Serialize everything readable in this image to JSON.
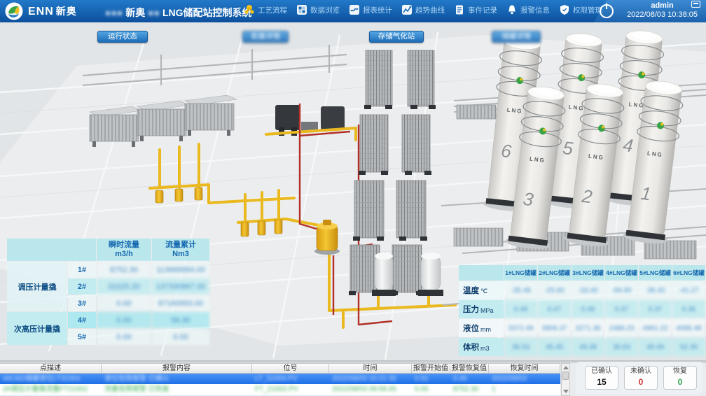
{
  "header": {
    "brand": "ENN",
    "brand_cn": "新奥",
    "title": {
      "blur_left": "●●●",
      "part1": "新奥",
      "blur_mid": "●●",
      "part2": "LNG储配站控制系统"
    },
    "toolbar": [
      {
        "label": "工艺流程",
        "icon": "process-flow-icon"
      },
      {
        "label": "数据浏览",
        "icon": "data-browse-icon"
      },
      {
        "label": "报表统计",
        "icon": "report-stats-icon"
      },
      {
        "label": "趋势曲线",
        "icon": "trend-curve-icon"
      },
      {
        "label": "事件记录",
        "icon": "event-log-icon"
      },
      {
        "label": "报警信息",
        "icon": "alarm-bell-icon"
      },
      {
        "label": "权限管理",
        "icon": "permission-shield-icon"
      }
    ],
    "user": "admin",
    "datetime": "2022/08/03 10:38:05"
  },
  "nav": {
    "buttons": [
      {
        "label": "运行状态"
      },
      {
        "label": "泵撬详情"
      },
      {
        "label": "存储气化站"
      },
      {
        "label": "储罐详情"
      }
    ]
  },
  "scene": {
    "tanks": [
      {
        "number": "6",
        "label": "LNG"
      },
      {
        "number": "5",
        "label": "LNG"
      },
      {
        "number": "4",
        "label": "LNG"
      },
      {
        "number": "3",
        "label": "LNG"
      },
      {
        "number": "2",
        "label": "LNG"
      },
      {
        "number": "1",
        "label": "LNG"
      }
    ]
  },
  "left_table": {
    "headers": {
      "flow": "瞬时流量",
      "flow_unit": "m3/h",
      "total": "流量累计",
      "total_unit": "Nm3"
    },
    "groups": [
      {
        "label": "调压计量撬"
      },
      {
        "label": "次高压计量撬"
      }
    ],
    "rows": [
      {
        "id": "1#",
        "flow": "8752.30",
        "total": "113666884.00"
      },
      {
        "id": "2#",
        "flow": "31025.20",
        "total": "137330867.00"
      },
      {
        "id": "3#",
        "flow": "0.00",
        "total": "87160993.00"
      },
      {
        "id": "4#",
        "flow": "0.00",
        "total": "56.30"
      },
      {
        "id": "5#",
        "flow": "0.00",
        "total": "0.00"
      }
    ]
  },
  "right_table": {
    "columns": [
      "1#LNG储罐",
      "2#LNG储罐",
      "3#LNG储罐",
      "4#LNG储罐",
      "5#LNG储罐",
      "6#LNG储罐"
    ],
    "rows": [
      {
        "label": "温度",
        "unit": "℃",
        "values": [
          "-35.48",
          "-25.60",
          "-33.40",
          "-69.90",
          "-36.40",
          "-41.27"
        ]
      },
      {
        "label": "压力",
        "unit": "MPa",
        "values": [
          "0.49",
          "0.47",
          "0.49",
          "0.47",
          "0.37",
          "0.36"
        ]
      },
      {
        "label": "液位",
        "unit": "mm",
        "values": [
          "3372.49",
          "3806.37",
          "3271.36",
          "2488.23",
          "4961.22",
          "4096.48"
        ]
      },
      {
        "label": "体积",
        "unit": "m3",
        "values": [
          "36.53",
          "45.45",
          "49.38",
          "30.63",
          "49.49",
          "52.30"
        ]
      }
    ]
  },
  "alarm_table": {
    "headers": [
      "点描述",
      "报警内容",
      "位号",
      "时间",
      "报警开始值",
      "报警恢复值",
      "恢复时间"
    ],
    "rows": [
      {
        "state": "selected",
        "cells": [
          "4#LNG储罐液位LT31004",
          "液位低限报警 已确认",
          "LT_31004.PV",
          "2022/08/03 10:21:35",
          "0.52",
          "0.49",
          "2022/08/03"
        ]
      },
      {
        "state": "recovered",
        "cells": [
          "2#调压计量撬流量FT21002",
          "流量低限报警 已恢复",
          "FT_21002.PV",
          "2022/08/03 09:58:45",
          "0.00",
          "8752.30",
          "1"
        ]
      }
    ]
  },
  "alarm_summary": [
    {
      "label": "已确认",
      "value": "15",
      "color": "#111111"
    },
    {
      "label": "未确认",
      "value": "0",
      "color": "#d03030"
    },
    {
      "label": "恢复",
      "value": "0",
      "color": "#2fa54a"
    }
  ]
}
